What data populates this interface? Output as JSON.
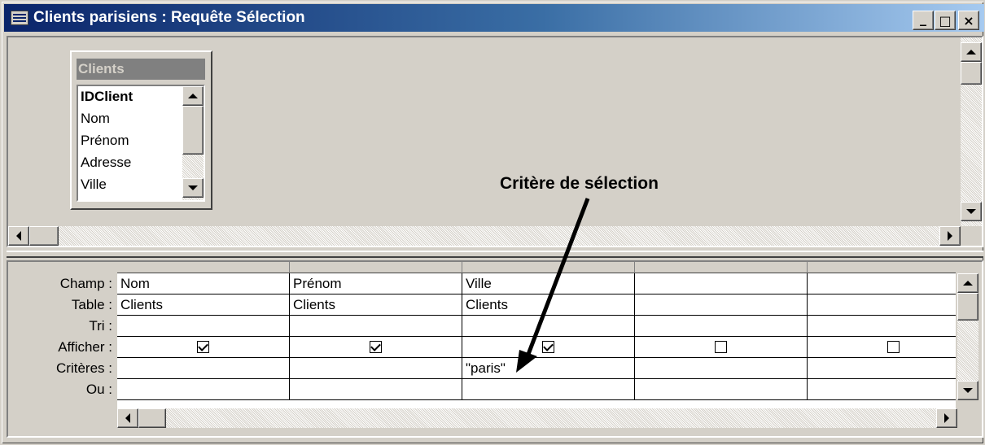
{
  "window": {
    "title": "Clients parisiens : Requête Sélection",
    "minimize": "_",
    "maximize": "□",
    "close": "×"
  },
  "field_list": {
    "title": "Clients",
    "fields": [
      "IDClient",
      "Nom",
      "Prénom",
      "Adresse",
      "Ville"
    ]
  },
  "annotation": "Critère de sélection",
  "grid": {
    "row_labels": [
      "Champ :",
      "Table :",
      "Tri :",
      "Afficher :",
      "Critères :",
      "Ou :"
    ],
    "columns": [
      {
        "champ": "Nom",
        "table": "Clients",
        "tri": "",
        "afficher": true,
        "criteres": "",
        "ou": ""
      },
      {
        "champ": "Prénom",
        "table": "Clients",
        "tri": "",
        "afficher": true,
        "criteres": "",
        "ou": ""
      },
      {
        "champ": "Ville",
        "table": "Clients",
        "tri": "",
        "afficher": true,
        "criteres": "\"paris\"",
        "ou": ""
      },
      {
        "champ": "",
        "table": "",
        "tri": "",
        "afficher": false,
        "criteres": "",
        "ou": ""
      },
      {
        "champ": "",
        "table": "",
        "tri": "",
        "afficher": false,
        "criteres": "",
        "ou": ""
      }
    ]
  },
  "icons": {
    "app": "query-window-icon",
    "checkbox": "checkmark-icon",
    "arrow": "annotation-arrow"
  },
  "colors": {
    "titlebar_start": "#0a246a",
    "titlebar_end": "#a6caf0",
    "face": "#d4d0c8"
  }
}
